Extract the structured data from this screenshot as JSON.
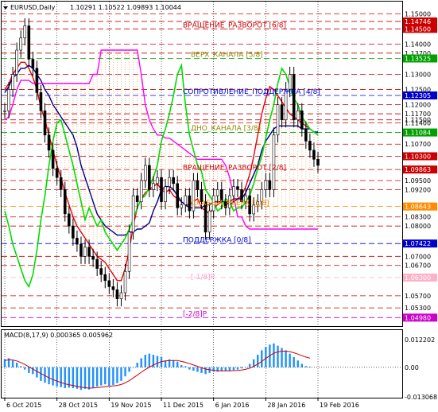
{
  "window": {
    "symbol": "EURUSD,Daily",
    "ohlc": "1.10291 1.10522 1.09893 1.10044"
  },
  "chart_data": [
    {
      "type": "candlestick",
      "title": "EURUSD,Daily",
      "ylim": [
        1.047,
        1.154
      ],
      "x_ticks": [
        "6 Oct 2015",
        "28 Oct 2015",
        "19 Nov 2015",
        "11 Dec 2015",
        "6 Jan 2016",
        "28 Jan 2016",
        "19 Feb 2016"
      ],
      "closes": [
        1.118,
        1.125,
        1.13,
        1.138,
        1.142,
        1.146,
        1.135,
        1.132,
        1.124,
        1.118,
        1.11,
        1.105,
        1.099,
        1.096,
        1.092,
        1.084,
        1.08,
        1.076,
        1.074,
        1.07,
        1.073,
        1.07,
        1.069,
        1.066,
        1.064,
        1.062,
        1.06,
        1.059,
        1.056,
        1.058,
        1.065,
        1.078,
        1.09,
        1.088,
        1.095,
        1.1,
        1.092,
        1.094,
        1.096,
        1.088,
        1.093,
        1.096,
        1.094,
        1.086,
        1.087,
        1.09,
        1.085,
        1.095,
        1.092,
        1.088,
        1.078,
        1.085,
        1.09,
        1.092,
        1.088,
        1.086,
        1.09,
        1.093,
        1.092,
        1.088,
        1.09,
        1.084,
        1.087,
        1.088,
        1.092,
        1.095,
        1.092,
        1.11,
        1.12,
        1.115,
        1.125,
        1.13,
        1.115,
        1.118,
        1.112,
        1.108,
        1.105,
        1.102,
        1.1
      ],
      "series": [
        {
          "name": "ma-red",
          "color": "#e8000b",
          "values": [
            1.125,
            1.127,
            1.13,
            1.132,
            1.134,
            1.134,
            1.132,
            1.129,
            1.125,
            1.119,
            1.115,
            1.11,
            1.105,
            1.1,
            1.096,
            1.091,
            1.087,
            1.083,
            1.08,
            1.078,
            1.076,
            1.074,
            1.072,
            1.07,
            1.069,
            1.068,
            1.066,
            1.064,
            1.062,
            1.062,
            1.066,
            1.072,
            1.08,
            1.086,
            1.089,
            1.091,
            1.092,
            1.093,
            1.094,
            1.092,
            1.091,
            1.092,
            1.09,
            1.089,
            1.088,
            1.087,
            1.087,
            1.088,
            1.089,
            1.086,
            1.085,
            1.084,
            1.086,
            1.087,
            1.088,
            1.088,
            1.088,
            1.089,
            1.089,
            1.09,
            1.093,
            1.097,
            1.103,
            1.11,
            1.117,
            1.122,
            1.126,
            1.125,
            1.123,
            1.121,
            1.119,
            1.117,
            1.116,
            1.115,
            1.114,
            1.113,
            1.112,
            1.111,
            1.11
          ]
        },
        {
          "name": "ma-blue",
          "color": "#00008b",
          "values": [
            1.124,
            1.126,
            1.129,
            1.13,
            1.132,
            1.132,
            1.133,
            1.132,
            1.13,
            1.128,
            1.125,
            1.123,
            1.12,
            1.118,
            1.116,
            1.114,
            1.112,
            1.11,
            1.106,
            1.1,
            1.096,
            1.092,
            1.088,
            1.084,
            1.082,
            1.08,
            1.079,
            1.078,
            1.077,
            1.077,
            1.077,
            1.078,
            1.078,
            1.079,
            1.079,
            1.08,
            1.081,
            1.085,
            1.088,
            1.092,
            1.093,
            1.093,
            1.092,
            1.09,
            1.088,
            1.087,
            1.086,
            1.086,
            1.086,
            1.086,
            1.087,
            1.087,
            1.088,
            1.088,
            1.088,
            1.088,
            1.087,
            1.088,
            1.089,
            1.089,
            1.091,
            1.094,
            1.097,
            1.1,
            1.105,
            1.108,
            1.11,
            1.112,
            1.113,
            1.113,
            1.113,
            1.113,
            1.113,
            1.113,
            1.112,
            1.112,
            1.112,
            1.111,
            1.111
          ]
        },
        {
          "name": "env-magenta",
          "color": "#ff00ff",
          "values": [
            1.115,
            1.116,
            1.12,
            1.125,
            1.128,
            1.128,
            1.128,
            1.127,
            1.127,
            1.127,
            1.127,
            1.127,
            1.127,
            1.127,
            1.127,
            1.127,
            1.127,
            1.127,
            1.127,
            1.127,
            1.127,
            1.127,
            1.13,
            1.13,
            1.138,
            1.138,
            1.138,
            1.138,
            1.138,
            1.138,
            1.138,
            1.138,
            1.138,
            1.138,
            1.13,
            1.12,
            1.115,
            1.112,
            1.11,
            1.11,
            1.109,
            1.109,
            1.108,
            1.107,
            1.106,
            1.105,
            1.104,
            1.103,
            1.102,
            1.102,
            1.102,
            1.102,
            1.102,
            1.102,
            1.102,
            1.1,
            1.096,
            1.09,
            1.083,
            1.083,
            1.08,
            1.079,
            1.079,
            1.079,
            1.079,
            1.079,
            1.079,
            1.079,
            1.079,
            1.079,
            1.079,
            1.079,
            1.079,
            1.079,
            1.079,
            1.079,
            1.079,
            1.079,
            1.079
          ]
        },
        {
          "name": "osc-green",
          "color": "#00dd00",
          "values": [
            1.085,
            1.08,
            1.074,
            1.07,
            1.066,
            1.062,
            1.06,
            1.064,
            1.072,
            1.082,
            1.09,
            1.1,
            1.108,
            1.114,
            1.115,
            1.11,
            1.105,
            1.1,
            1.094,
            1.088,
            1.082,
            1.086,
            1.083,
            1.08,
            1.082,
            1.078,
            1.076,
            1.074,
            1.072,
            1.074,
            1.076,
            1.079,
            1.082,
            1.086,
            1.089,
            1.09,
            1.093,
            1.096,
            1.1,
            1.108,
            1.112,
            1.117,
            1.123,
            1.13,
            1.133,
            1.12,
            1.11,
            1.105,
            1.1,
            1.098,
            1.092,
            1.09,
            1.088,
            1.085,
            1.086,
            1.089,
            1.088,
            1.085,
            1.086,
            1.086,
            1.088,
            1.09,
            1.094,
            1.099,
            1.103,
            1.109,
            1.115,
            1.12,
            1.127,
            1.132,
            1.13,
            1.126,
            1.122,
            1.12,
            1.116,
            1.114,
            1.112,
            1.111,
            1.11
          ]
        }
      ],
      "levels": [
        {
          "label": "ВРАЩЕНИЕ_РАЗВОРОТ [6/8]",
          "price": 1.145,
          "color": "#cc0000"
        },
        {
          "label": "ВЕРХ_КАНАЛА [5/8]",
          "price": 1.1352,
          "color": "#8b8b00"
        },
        {
          "label": "СОПРОТИВЛЕНИЕ_ПОДДЕРЖКА [4/8]",
          "price": 1.123,
          "color": "#0000cc"
        },
        {
          "label": "ДНО_КАНАЛА [3/8]",
          "price": 1.111,
          "color": "#8b8b00"
        },
        {
          "label": "ВРАЩЕНИЕ_РАЗВОРОТ [2/8]",
          "price": 1.098,
          "color": "#cc0000"
        },
        {
          "label": "СЛАБЫЙ_ВВЕРХ [1/8]",
          "price": 1.0864,
          "color": "#ff8c00"
        },
        {
          "label": "ПОДДЕРЖКА [0/8]",
          "price": 1.0742,
          "color": "#0000cc"
        },
        {
          "label": "[-1/8]P",
          "price": 1.062,
          "color": "#ff99cc"
        },
        {
          "label": "[-2/8]P",
          "price": 1.0498,
          "color": "#cc00cc"
        }
      ],
      "price_ticks": [
        "1.15000",
        "1.14746",
        "1.14500",
        "1.14000",
        "1.13700",
        "1.13525",
        "1.13000",
        "1.12500",
        "1.12305",
        "1.12000",
        "1.11700",
        "1.11500",
        "1.11400",
        "1.11084",
        "1.10700",
        "1.10300",
        "1.09863",
        "1.09500",
        "1.09200",
        "1.08643",
        "1.08300",
        "1.08000",
        "1.07422",
        "1.07000",
        "1.06700",
        "1.06300",
        "1.05700",
        "1.05300",
        "1.04980"
      ],
      "price_tag_colors": {
        "1.14746": "#cc0000",
        "1.14500": "#cc0000",
        "1.13525": "#00a000",
        "1.12305": "#0000cc",
        "1.11084": "#00a000",
        "1.10300": "#cc0000",
        "1.09863": "#cc0000",
        "1.08643": "#ff8c00",
        "1.07422": "#0000cc",
        "1.06300": "#ffb0c8",
        "1.04980": "#cc00cc"
      }
    },
    {
      "type": "bar",
      "title": "MACD(8,17,9) 0.000365 0.005962",
      "ylim": [
        -0.013068,
        0.012202
      ],
      "y_ticks": [
        "0.012202",
        "0.00",
        "-0.013068"
      ],
      "series": [
        {
          "name": "macd",
          "color": "#1e90ff",
          "values": [
            0.0035,
            0.004,
            0.003,
            0.002,
            0.0005,
            -0.001,
            -0.0025,
            -0.003,
            -0.0045,
            -0.006,
            -0.0068,
            -0.0075,
            -0.008,
            -0.0085,
            -0.0088,
            -0.0092,
            -0.009,
            -0.0092,
            -0.0095,
            -0.01,
            -0.0095,
            -0.0098,
            -0.009,
            -0.0085,
            -0.008,
            -0.0075,
            -0.0082,
            -0.0078,
            -0.007,
            -0.006,
            -0.004,
            -0.002,
            0.0,
            0.002,
            0.004,
            0.0055,
            0.006,
            0.0055,
            0.005,
            0.0045,
            0.003,
            0.0035,
            0.003,
            0.0025,
            0.001,
            0.0005,
            -0.001,
            -0.0015,
            -0.002,
            -0.0025,
            -0.003,
            -0.0025,
            -0.002,
            -0.002,
            -0.0018,
            -0.0015,
            -0.0015,
            -0.0012,
            -0.001,
            -0.0005,
            0.0,
            0.0015,
            0.0035,
            0.0055,
            0.0075,
            0.009,
            0.01,
            0.0105,
            0.0095,
            0.0085,
            0.0075,
            0.006,
            0.0045,
            0.003,
            0.0015,
            0.0005,
            0.0003
          ]
        },
        {
          "name": "signal",
          "color": "#cc0000",
          "values": [
            0.003,
            0.0033,
            0.0032,
            0.0028,
            0.0021,
            0.0012,
            0.0002,
            -0.0008,
            -0.0018,
            -0.0028,
            -0.0037,
            -0.0046,
            -0.0054,
            -0.0061,
            -0.0067,
            -0.0073,
            -0.0077,
            -0.008,
            -0.0084,
            -0.0088,
            -0.009,
            -0.0092,
            -0.0091,
            -0.009,
            -0.0088,
            -0.0085,
            -0.0084,
            -0.0082,
            -0.008,
            -0.0076,
            -0.0069,
            -0.0059,
            -0.0047,
            -0.0035,
            -0.0022,
            -0.001,
            0.0,
            0.001,
            0.0018,
            0.0025,
            0.0028,
            0.003,
            0.003,
            0.003,
            0.0026,
            0.0022,
            0.0016,
            0.001,
            0.0004,
            -0.0002,
            -0.0008,
            -0.0011,
            -0.0013,
            -0.0015,
            -0.0016,
            -0.0016,
            -0.0016,
            -0.0015,
            -0.0014,
            -0.0012,
            -0.0009,
            -0.0004,
            0.0004,
            0.0014,
            0.0026,
            0.0039,
            0.0051,
            0.0062,
            0.0068,
            0.0071,
            0.0071,
            0.0069,
            0.0064,
            0.0058,
            0.0051,
            0.0045,
            0.004
          ]
        }
      ]
    }
  ]
}
